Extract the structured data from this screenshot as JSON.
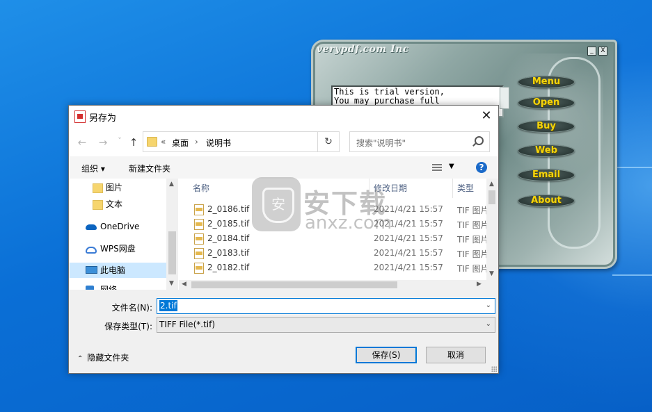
{
  "skin_app": {
    "title": "verypdf.com Inc",
    "window_buttons": [
      "_",
      "X"
    ],
    "text_lines": "This is trial version,\nYou may purchase full",
    "menu_buttons": [
      "Menu",
      "Open",
      "Buy",
      "Web",
      "Email",
      "About"
    ]
  },
  "dialog": {
    "title": "另存为",
    "close_glyph": "✕",
    "nav": {
      "back": "←",
      "forward": "→",
      "recent": "˅",
      "up": "↑"
    },
    "address": {
      "prefix": "«",
      "crumbs": [
        "桌面",
        "说明书"
      ],
      "sep": "›"
    },
    "search_placeholder": "搜索\"说明书\"",
    "toolbar": {
      "organize": "组织 ▾",
      "new_folder": "新建文件夹"
    },
    "nav_pane": [
      {
        "label": "图片",
        "icon": "folder-icon"
      },
      {
        "label": "文本",
        "icon": "folder-icon"
      },
      {
        "label": "OneDrive",
        "icon": "cloud-icon"
      },
      {
        "label": "WPS网盘",
        "icon": "cloud-outline-icon"
      },
      {
        "label": "此电脑",
        "icon": "computer-icon",
        "selected": true
      },
      {
        "label": "网络",
        "icon": "network-icon"
      }
    ],
    "columns": {
      "name": "名称",
      "date": "修改日期",
      "type": "类型"
    },
    "files": [
      {
        "name": "2_0186.tif",
        "date": "2021/4/21 15:57",
        "type": "TIF 图片"
      },
      {
        "name": "2_0185.tif",
        "date": "2021/4/21 15:57",
        "type": "TIF 图片"
      },
      {
        "name": "2_0184.tif",
        "date": "2021/4/21 15:57",
        "type": "TIF 图片"
      },
      {
        "name": "2_0183.tif",
        "date": "2021/4/21 15:57",
        "type": "TIF 图片"
      },
      {
        "name": "2_0182.tif",
        "date": "2021/4/21 15:57",
        "type": "TIF 图片"
      }
    ],
    "filename_label": "文件名(N):",
    "filename_value": "2.tif",
    "filetype_label": "保存类型(T):",
    "filetype_value": "TIFF File(*.tif)",
    "hide_folders": "隐藏文件夹",
    "save_button": "保存(S)",
    "cancel_button": "取消"
  },
  "watermark": {
    "cn": "安下载",
    "en": "anxz.com",
    "shield": "安"
  }
}
